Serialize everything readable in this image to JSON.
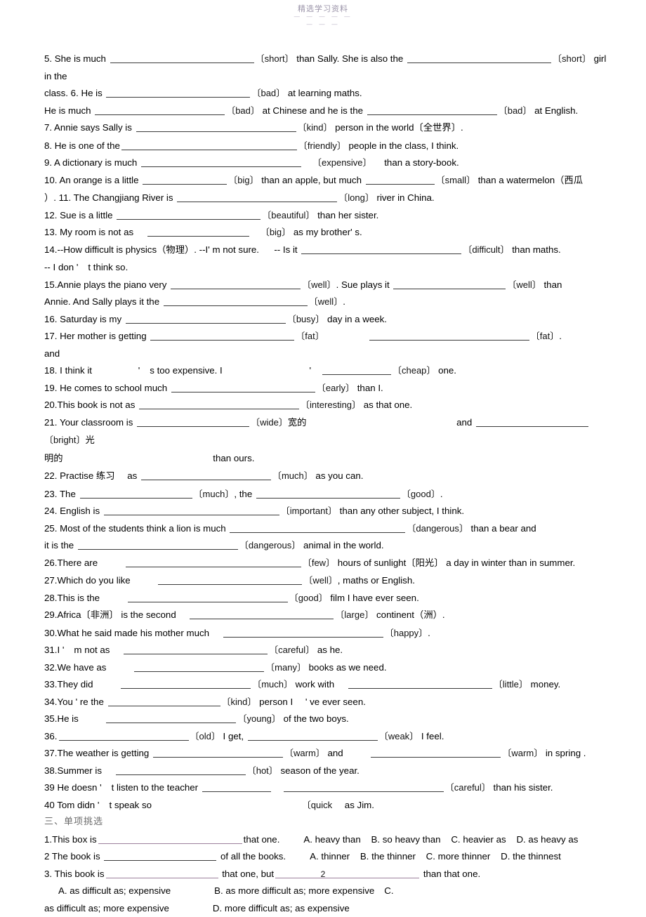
{
  "document": {
    "watermark_title": "精选学习资料",
    "watermark_sub": "— — — — —",
    "watermark_sub2": "— — —",
    "page_number": "2"
  },
  "fill_in_blanks": {
    "items": [
      {
        "id": "q5",
        "segments": [
          "5. She is much ",
          "BLANK:b-4xl",
          "CUE:〔short〕",
          " than Sally. She is also the ",
          "BLANK:b-4xl",
          "CUE:〔short〕",
          " girl in the"
        ]
      },
      {
        "id": "q5b-q6",
        "segments": [
          "class. 6. He is ",
          "BLANK:b-4xl",
          "CUE:〔bad〕",
          " at learning maths."
        ]
      },
      {
        "id": "q6b",
        "segments": [
          "He is much ",
          "BLANK:b-3xl",
          "CUE:〔bad〕",
          " at Chinese and he is the ",
          "BLANK:b-3xl",
          "CUE:〔bad〕",
          " at English."
        ]
      },
      {
        "id": "q7",
        "segments": [
          "7. Annie says Sally is ",
          "BLANK:b-5xl",
          "CUE:〔kind〕",
          " person in the world〔",
          "CN:全世界",
          "〕."
        ]
      },
      {
        "id": "q8",
        "segments": [
          "8. He is one of the",
          "BLANK:b-6xl",
          "CUE:〔friendly〕",
          " people in the class, I think."
        ]
      },
      {
        "id": "q9",
        "segments": [
          "9. A dictionary is much ",
          "BLANK:b-5xl",
          "GAP:gap-s",
          "CUE:〔expensive〕",
          "GAP:gap-s",
          " than a story-book."
        ]
      },
      {
        "id": "q10",
        "segments": [
          "10. An orange is a little ",
          "BLANK:b-lg",
          "CUE:〔big〕",
          " than an apple, but much ",
          "BLANK:b-md",
          "CUE:〔small〕",
          " than a watermelon（",
          "CN:西瓜",
          ""
        ]
      },
      {
        "id": "q10b-q11",
        "segments": [
          "）. 11. The Changjiang River is ",
          "BLANK:b-5xl",
          "CUE:〔long〕",
          " river in China."
        ]
      },
      {
        "id": "q12",
        "segments": [
          "12. Sue is a little ",
          "BLANK:b-4xl",
          "CUE:〔beautiful〕",
          " than her sister."
        ]
      },
      {
        "id": "q13",
        "segments": [
          "13. My room is not as ",
          "GAP:gap-s",
          "BLANK:b-xl",
          "GAP:gap-s",
          "CUE:〔big〕",
          " as my brother' s."
        ]
      },
      {
        "id": "q14",
        "segments": [
          "14.--How difficult is physics（",
          "CN:物理",
          "）. --I' m not sure. ",
          "GAP:gap-s",
          " -- Is it ",
          "BLANK:b-5xl",
          "CUE:〔difficult〕",
          " than maths."
        ]
      },
      {
        "id": "q14b",
        "segments": [
          "-- I don '",
          "GAP:gap-s",
          "t think so."
        ]
      },
      {
        "id": "q15",
        "segments": [
          "15.Annie plays the piano very ",
          "BLANK:b-3xl",
          "CUE:〔well〕",
          ". Sue plays it ",
          "BLANK:b-2xl",
          "CUE:〔well〕",
          " than"
        ]
      },
      {
        "id": "q15b",
        "segments": [
          "Annie. And Sally plays it the ",
          "BLANK:b-4xl",
          "CUE:〔well〕",
          "."
        ]
      },
      {
        "id": "q16",
        "segments": [
          "16. Saturday is my ",
          "BLANK:b-5xl",
          "CUE:〔busy〕",
          " day in a week."
        ]
      },
      {
        "id": "q17",
        "segments": [
          "17. Her mother is getting ",
          "BLANK:b-4xl",
          "CUE:〔fat〕",
          "GAP:gap-l",
          "BLANK:b-5xl",
          "CUE:〔fat〕",
          "."
        ]
      },
      {
        "id": "q17b",
        "segments": [
          "and"
        ]
      },
      {
        "id": "q18",
        "segments": [
          "18. I think it ",
          "GAP:gap-l",
          "'",
          "GAP:gap-s",
          "s too expensive. I ",
          "GAP:gap-xl",
          "'",
          "GAP:gap-s",
          "BLANK:b-md",
          "CUE:〔cheap〕",
          " one."
        ]
      },
      {
        "id": "q19",
        "segments": [
          "19. He comes to school much ",
          "BLANK:b-4xl",
          "CUE:〔early〕",
          " than I."
        ]
      },
      {
        "id": "q20",
        "segments": [
          "20.This book is not as ",
          "BLANK:b-5xl",
          "CUE:〔interesting〕",
          " as that one."
        ]
      },
      {
        "id": "q21",
        "segments": [
          "21. Your classroom is ",
          "BLANK:b-2xl",
          "CUE:〔wide〕",
          "CN:宽的",
          "GAP:gap-xxl",
          " and ",
          "BLANK:b-2xl",
          "CUE:〔bright〕",
          "CN:光"
        ]
      },
      {
        "id": "q21b",
        "segments": [
          "CN:明的",
          "GAP:gap-xxl",
          " than ours."
        ]
      },
      {
        "id": "q22",
        "segments": [
          "22. Practise ",
          "CN:练习",
          "GAP:gap-s",
          " as ",
          "BLANK:b-3xl",
          "CUE:〔much〕",
          " as you can."
        ]
      },
      {
        "id": "q23",
        "segments": [
          "23. The ",
          "BLANK:b-2xl",
          "CUE:〔much〕",
          ", the ",
          "BLANK:b-4xl",
          "CUE:〔good〕",
          "."
        ]
      },
      {
        "id": "q24",
        "segments": [
          "24. English is ",
          "BLANK:b-6xl",
          "CUE:〔important〕",
          " than any other subject, I think."
        ]
      },
      {
        "id": "q25",
        "segments": [
          "25. Most of the students think a lion is much ",
          "BLANK:b-6xl",
          "CUE:〔dangerous〕",
          " than a bear and"
        ]
      },
      {
        "id": "q25b",
        "segments": [
          "it is the ",
          "BLANK:b-5xl",
          "CUE:〔dangerous〕",
          " animal in the world."
        ]
      },
      {
        "id": "q26",
        "segments": [
          "26.There are ",
          "GAP:gap-m",
          "BLANK:b-6xl",
          "CUE:〔few〕",
          " hours of sunlight〔",
          "CN:阳光",
          "〕 a day in winter than in summer."
        ]
      },
      {
        "id": "q27",
        "segments": [
          "27.Which do you like ",
          "GAP:gap-m",
          "BLANK:b-4xl",
          "CUE:〔well〕",
          ", maths or English."
        ]
      },
      {
        "id": "q28",
        "segments": [
          "28.This is the ",
          "GAP:gap-m",
          "BLANK:b-5xl",
          "CUE:〔good〕",
          " film I have ever seen."
        ]
      },
      {
        "id": "q29",
        "segments": [
          "29.Africa〔",
          "CN:非洲",
          "〕 is the second ",
          "GAP:gap-s",
          "BLANK:b-4xl",
          "CUE:〔large〕",
          " continent（",
          "CN:洲",
          "）."
        ]
      },
      {
        "id": "q30",
        "segments": [
          "30.What he said made his mother much ",
          "GAP:gap-s",
          "BLANK:b-5xl",
          "CUE:〔happy〕",
          "."
        ]
      },
      {
        "id": "q31",
        "segments": [
          "31.I '",
          "GAP:gap-s",
          "m not as ",
          "GAP:gap-s",
          "BLANK:b-4xl",
          "CUE:〔careful〕",
          " as he."
        ]
      },
      {
        "id": "q32",
        "segments": [
          "32.We have as ",
          "GAP:gap-m",
          "BLANK:b-3xl",
          "CUE:〔many〕",
          " books as we need."
        ]
      },
      {
        "id": "q33",
        "segments": [
          "33.They did ",
          "GAP:gap-m",
          "BLANK:b-3xl",
          "CUE:〔much〕",
          " work with ",
          "GAP:gap-s",
          "BLANK:b-4xl",
          "CUE:〔little〕",
          " money."
        ]
      },
      {
        "id": "q34",
        "segments": [
          "34.You ' re the ",
          "BLANK:b-2xl",
          "CUE:〔kind〕",
          " person I ",
          "GAP:gap-s",
          "' ve ever seen."
        ]
      },
      {
        "id": "q35",
        "segments": [
          "35.He is ",
          "GAP:gap-m",
          "BLANK:b-3xl",
          "CUE:〔young〕",
          " of the two boys."
        ]
      },
      {
        "id": "q36",
        "segments": [
          "36.",
          "BLANK:b-3xl",
          "CUE:〔old〕",
          " I get, ",
          "BLANK:b-3xl",
          "CUE:〔weak〕",
          " I feel."
        ]
      },
      {
        "id": "q37",
        "segments": [
          "37.The weather is getting ",
          "BLANK:b-3xl",
          "CUE:〔warm〕",
          " and ",
          "GAP:gap-m",
          "BLANK:b-3xl",
          "CUE:〔warm〕",
          " in spring ."
        ]
      },
      {
        "id": "q38",
        "segments": [
          "38.Summer is ",
          "GAP:gap-s",
          "BLANK:b-3xl",
          "CUE:〔hot〕",
          " season of the year."
        ]
      },
      {
        "id": "q39",
        "segments": [
          "39 He doesn '",
          "GAP:gap-s",
          "t listen to the teacher ",
          "BLANK:b-md",
          "GAP:gap-s",
          "BLANK:b-5xl",
          "CUE:〔careful〕",
          " than his sister."
        ]
      },
      {
        "id": "q40",
        "segments": [
          "40 Tom didn '",
          "GAP:gap-s",
          "t speak so ",
          "GAP:gap-xxl",
          "CUE:〔quick",
          "GAP:gap-s",
          " as Jim."
        ]
      }
    ]
  },
  "multiple_choice": {
    "heading": "三、单项挑选",
    "questions": [
      {
        "id": "mc1",
        "stem_before": "1.This box is",
        "stem_after": "that one.",
        "choices_inline": "A. heavy than    B. so heavy than    C. heavier as    D. as heavy as"
      },
      {
        "id": "mc2",
        "stem_before": "2 The book is",
        "stem_after": "of all the books.",
        "choices_inline": "A. thinner    B. the thinner    C. more thinner    D. the thinnest"
      },
      {
        "id": "mc3",
        "stem_before": "3. This book is",
        "stem_mid": "that one, but",
        "stem_after": "than that one.",
        "choice_a": "A. as difficult as; expensive",
        "choice_b": "B. as more difficult as; more expensive",
        "choice_c_label": "C.",
        "choice_c_text": "as difficult as; more expensive",
        "choice_d": "D. more difficult as; as expensive"
      }
    ]
  }
}
